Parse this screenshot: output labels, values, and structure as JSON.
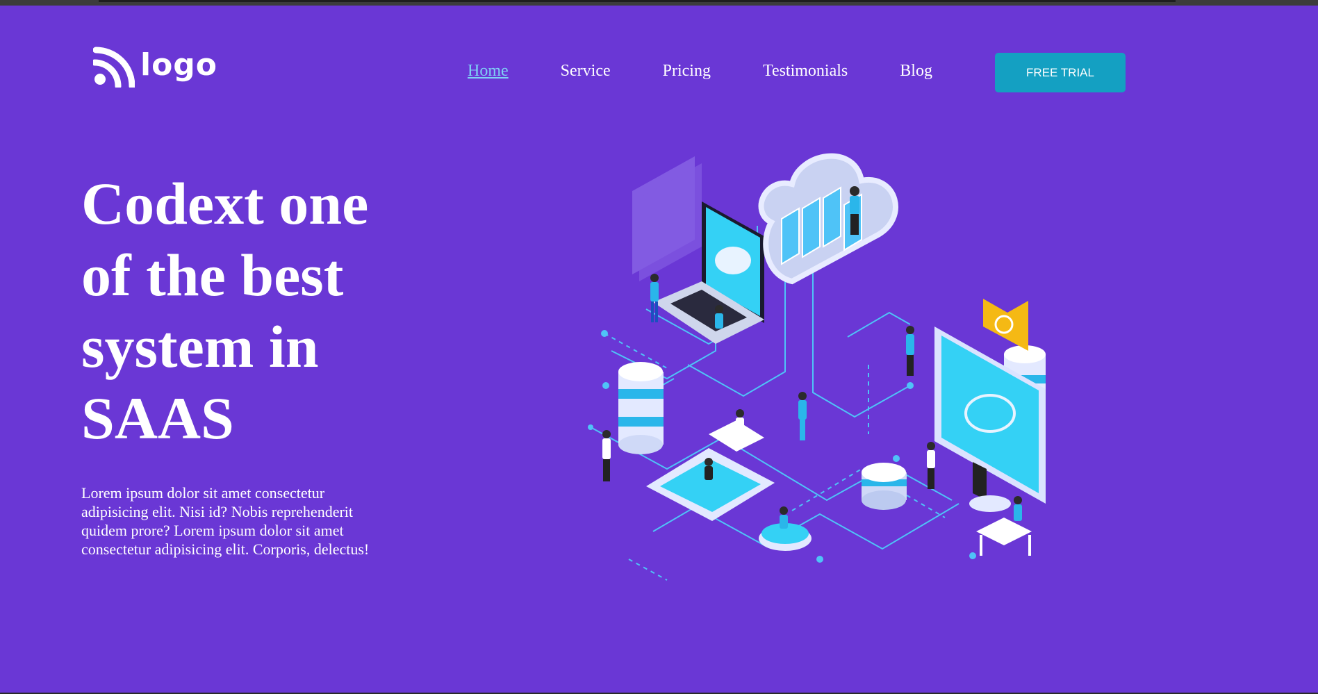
{
  "brand": {
    "logo_text": "logo",
    "logo_icon": "wifi-signal-icon"
  },
  "nav": {
    "items": [
      {
        "label": "Home",
        "active": true
      },
      {
        "label": "Service",
        "active": false
      },
      {
        "label": "Pricing",
        "active": false
      },
      {
        "label": "Testimonials",
        "active": false
      },
      {
        "label": "Blog",
        "active": false
      }
    ],
    "cta_label": "FREE TRIAL"
  },
  "hero": {
    "title": "Codext one of the best system in SAAS",
    "description": "Lorem ipsum dolor sit amet consectetur adipisicing elit. Nisi id? Nobis reprehenderit quidem prore? Lorem ipsum dolor sit amet consectetur adipisicing elit. Corporis, delectus!",
    "illustration": "isometric-cloud-network-illustration"
  },
  "colors": {
    "background": "#6a37d5",
    "accent": "#14a0c2",
    "active_link": "#7fd0f5",
    "text": "#ffffff"
  }
}
